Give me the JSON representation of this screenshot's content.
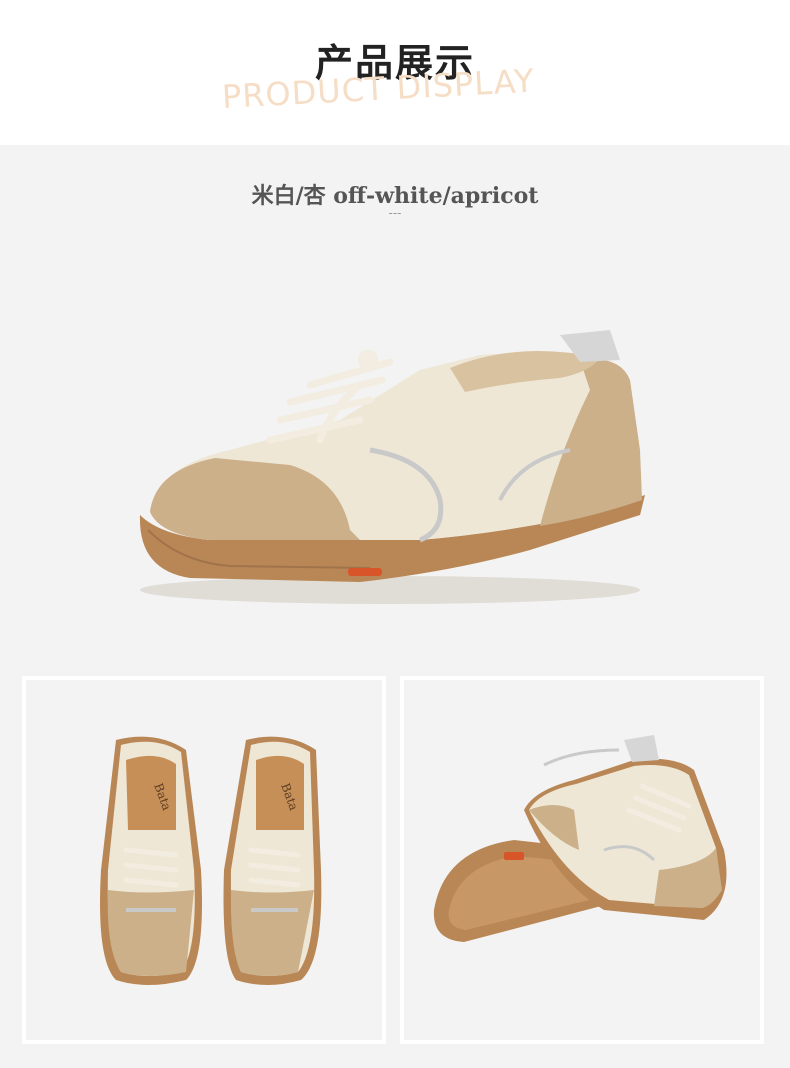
{
  "header": {
    "title": "产品展示",
    "subtitle": "PRODUCT DISPLAY"
  },
  "product": {
    "color_label": "米白/杏 off-white/apricot",
    "divider": "---",
    "top_view_brand_text": "Bata"
  },
  "colors": {
    "page_background": "#f3f3f3",
    "header_background": "#ffffff",
    "subtitle_peach": "#f6ddc5",
    "shoe_cream": "#efe7d6",
    "shoe_suede": "#cbb08a",
    "sole_gum": "#b98756",
    "accent_silver": "#c9c9c9",
    "accent_orange": "#d8552a"
  }
}
